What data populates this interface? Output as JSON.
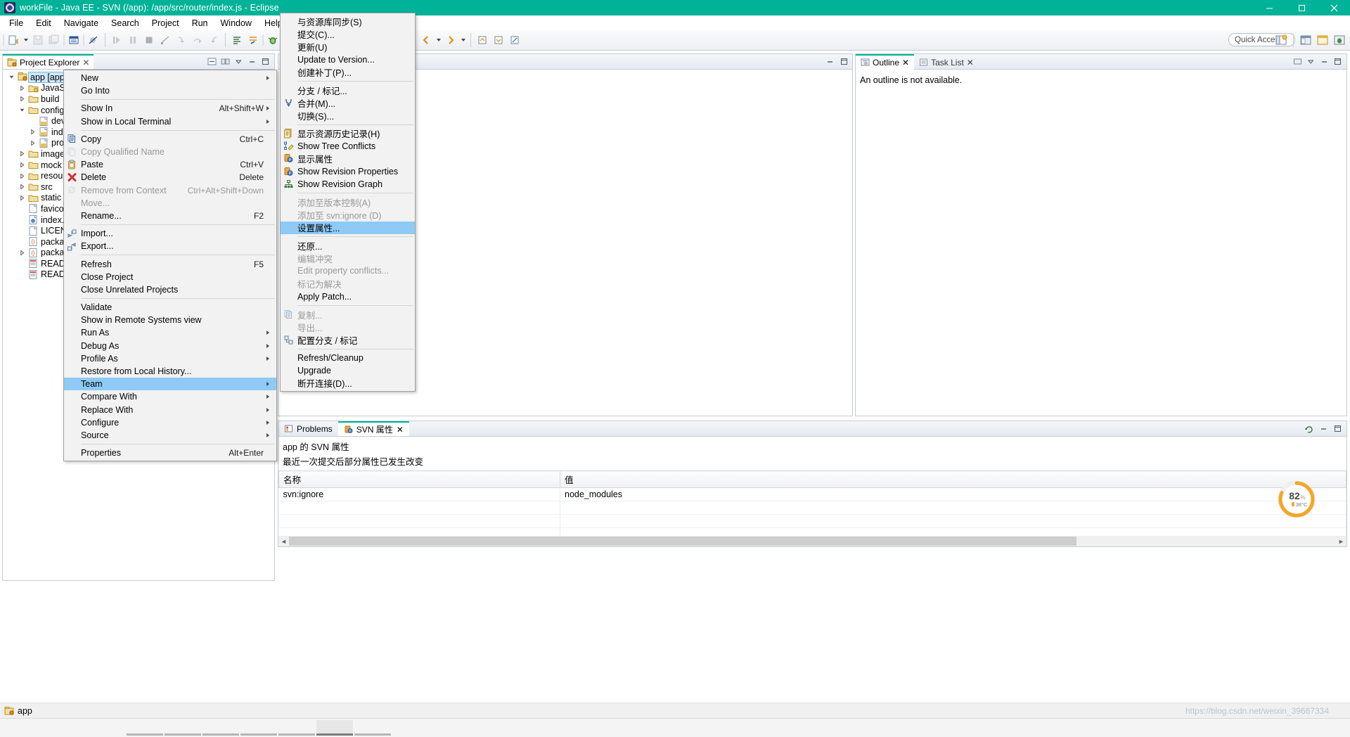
{
  "window": {
    "title": "workFile - Java EE - SVN (/app): /app/src/router/index.js - Eclipse",
    "minimize": "–",
    "maximize": "□",
    "close": "✕"
  },
  "menubar": [
    "File",
    "Edit",
    "Navigate",
    "Search",
    "Project",
    "Run",
    "Window",
    "Help"
  ],
  "toolbar": {
    "quick_access_placeholder": "Quick Access"
  },
  "project_explorer": {
    "tab_label": "Project Explorer",
    "tab_close": "✕",
    "tree": [
      {
        "label": "app [app-arrangement/app]",
        "indent": 0,
        "twisty": "down",
        "icon": "project",
        "selected": true
      },
      {
        "label": "JavaScr",
        "indent": 1,
        "twisty": "right",
        "icon": "folder-js"
      },
      {
        "label": "build",
        "indent": 1,
        "twisty": "right",
        "icon": "folder"
      },
      {
        "label": "config",
        "indent": 1,
        "twisty": "down",
        "icon": "folder"
      },
      {
        "label": "dev",
        "indent": 2,
        "twisty": "none",
        "icon": "file-js"
      },
      {
        "label": "inde",
        "indent": 2,
        "twisty": "right",
        "icon": "file-js"
      },
      {
        "label": "pro",
        "indent": 2,
        "twisty": "right",
        "icon": "file-js"
      },
      {
        "label": "images",
        "indent": 1,
        "twisty": "right",
        "icon": "folder"
      },
      {
        "label": "mock",
        "indent": 1,
        "twisty": "right",
        "icon": "folder"
      },
      {
        "label": "resourc",
        "indent": 1,
        "twisty": "right",
        "icon": "folder"
      },
      {
        "label": "src",
        "indent": 1,
        "twisty": "right",
        "icon": "folder"
      },
      {
        "label": "static",
        "indent": 1,
        "twisty": "right",
        "icon": "folder"
      },
      {
        "label": "favicon",
        "indent": 1,
        "twisty": "none",
        "icon": "file"
      },
      {
        "label": "index.h",
        "indent": 1,
        "twisty": "none",
        "icon": "file-html"
      },
      {
        "label": "LICENS",
        "indent": 1,
        "twisty": "none",
        "icon": "file"
      },
      {
        "label": "packag",
        "indent": 1,
        "twisty": "none",
        "icon": "file-json"
      },
      {
        "label": "packag",
        "indent": 1,
        "twisty": "right",
        "icon": "file-json"
      },
      {
        "label": "README",
        "indent": 1,
        "twisty": "none",
        "icon": "file-md"
      },
      {
        "label": "README",
        "indent": 1,
        "twisty": "none",
        "icon": "file-md"
      }
    ]
  },
  "outline": {
    "tabs": [
      {
        "label": "Outline",
        "active": true,
        "close": "✕"
      },
      {
        "label": "Task List",
        "active": false,
        "close": "✕"
      }
    ],
    "empty_message": "An outline is not available."
  },
  "bottom_panel": {
    "tabs": [
      {
        "label": "Problems",
        "active": false
      },
      {
        "label": "SVN 属性",
        "active": true,
        "close": "✕"
      }
    ],
    "title": "app 的 SVN 属性",
    "subtitle": "最近一次提交后部分属性已发生改变",
    "columns": [
      "名称",
      "值"
    ],
    "rows": [
      {
        "name": "svn:ignore",
        "value": "node_modules"
      }
    ]
  },
  "temperature_widget": {
    "percent": "82",
    "percent_unit": "%",
    "temp": "38°C",
    "accent": "#f5a623"
  },
  "statusbar": {
    "label": "app"
  },
  "watermark": "https://blog.csdn.net/weixin_39667334",
  "context_menu": {
    "items": [
      {
        "label": "New",
        "arrow": true,
        "type": "item"
      },
      {
        "label": "Go Into",
        "type": "item"
      },
      {
        "type": "sep"
      },
      {
        "label": "Show In",
        "accel": "Alt+Shift+W",
        "arrow": true,
        "type": "item"
      },
      {
        "label": "Show in Local Terminal",
        "arrow": true,
        "type": "item"
      },
      {
        "type": "sep"
      },
      {
        "label": "Copy",
        "accel": "Ctrl+C",
        "icon": "copy",
        "type": "item"
      },
      {
        "label": "Copy Qualified Name",
        "icon": "copy-qualified",
        "disabled": true,
        "type": "item"
      },
      {
        "label": "Paste",
        "accel": "Ctrl+V",
        "icon": "paste",
        "type": "item"
      },
      {
        "label": "Delete",
        "accel": "Delete",
        "icon": "delete",
        "type": "item"
      },
      {
        "label": "Remove from Context",
        "accel": "Ctrl+Alt+Shift+Down",
        "icon": "remove-context",
        "disabled": true,
        "type": "item"
      },
      {
        "label": "Move...",
        "disabled": true,
        "type": "item"
      },
      {
        "label": "Rename...",
        "accel": "F2",
        "type": "item"
      },
      {
        "type": "sep"
      },
      {
        "label": "Import...",
        "icon": "import",
        "type": "item"
      },
      {
        "label": "Export...",
        "icon": "export",
        "type": "item"
      },
      {
        "type": "sep"
      },
      {
        "label": "Refresh",
        "accel": "F5",
        "type": "item"
      },
      {
        "label": "Close Project",
        "type": "item"
      },
      {
        "label": "Close Unrelated Projects",
        "type": "item"
      },
      {
        "type": "sep"
      },
      {
        "label": "Validate",
        "type": "item"
      },
      {
        "label": "Show in Remote Systems view",
        "type": "item"
      },
      {
        "label": "Run As",
        "arrow": true,
        "type": "item"
      },
      {
        "label": "Debug As",
        "arrow": true,
        "type": "item"
      },
      {
        "label": "Profile As",
        "arrow": true,
        "type": "item"
      },
      {
        "label": "Restore from Local History...",
        "type": "item"
      },
      {
        "label": "Team",
        "arrow": true,
        "selected": true,
        "type": "item"
      },
      {
        "label": "Compare With",
        "arrow": true,
        "type": "item"
      },
      {
        "label": "Replace With",
        "arrow": true,
        "type": "item"
      },
      {
        "label": "Configure",
        "arrow": true,
        "type": "item"
      },
      {
        "label": "Source",
        "arrow": true,
        "type": "item"
      },
      {
        "type": "sep"
      },
      {
        "label": "Properties",
        "accel": "Alt+Enter",
        "type": "item"
      }
    ]
  },
  "team_submenu": {
    "items": [
      {
        "label": "与资源库同步(S)",
        "type": "item"
      },
      {
        "label": "提交(C)...",
        "type": "item"
      },
      {
        "label": "更新(U)",
        "type": "item"
      },
      {
        "label": "Update to Version...",
        "type": "item"
      },
      {
        "label": "创建补丁(P)...",
        "type": "item"
      },
      {
        "type": "sep"
      },
      {
        "label": "分支 / 标记...",
        "type": "item"
      },
      {
        "label": "合并(M)...",
        "icon": "merge",
        "type": "item"
      },
      {
        "label": "切换(S)...",
        "type": "item"
      },
      {
        "type": "sep"
      },
      {
        "label": "显示资源历史记录(H)",
        "icon": "history",
        "type": "item"
      },
      {
        "label": "Show Tree Conflicts",
        "icon": "tree-conflicts",
        "type": "item"
      },
      {
        "label": "显示属性",
        "icon": "props",
        "type": "item"
      },
      {
        "label": "Show Revision Properties",
        "icon": "props",
        "type": "item"
      },
      {
        "label": "Show Revision Graph",
        "icon": "graph",
        "type": "item"
      },
      {
        "type": "sep"
      },
      {
        "label": "添加至版本控制(A)",
        "disabled": true,
        "type": "item"
      },
      {
        "label": "添加至 svn:ignore (D)",
        "disabled": true,
        "type": "item"
      },
      {
        "label": "设置属性...",
        "selected": true,
        "type": "item"
      },
      {
        "type": "sep"
      },
      {
        "label": "还原...",
        "type": "item"
      },
      {
        "label": "编辑冲突",
        "disabled": true,
        "type": "item"
      },
      {
        "label": "Edit property conflicts...",
        "disabled": true,
        "type": "item"
      },
      {
        "label": "标记为解决",
        "disabled": true,
        "type": "item"
      },
      {
        "label": "Apply Patch...",
        "type": "item"
      },
      {
        "type": "sep"
      },
      {
        "label": "复制...",
        "icon": "copy",
        "disabled": true,
        "type": "item"
      },
      {
        "label": "导出...",
        "disabled": true,
        "type": "item"
      },
      {
        "label": "配置分支 / 标记",
        "icon": "branch-config",
        "type": "item"
      },
      {
        "type": "sep"
      },
      {
        "label": "Refresh/Cleanup",
        "type": "item"
      },
      {
        "label": "Upgrade",
        "type": "item"
      },
      {
        "label": "断开连接(D)...",
        "type": "item"
      }
    ]
  }
}
